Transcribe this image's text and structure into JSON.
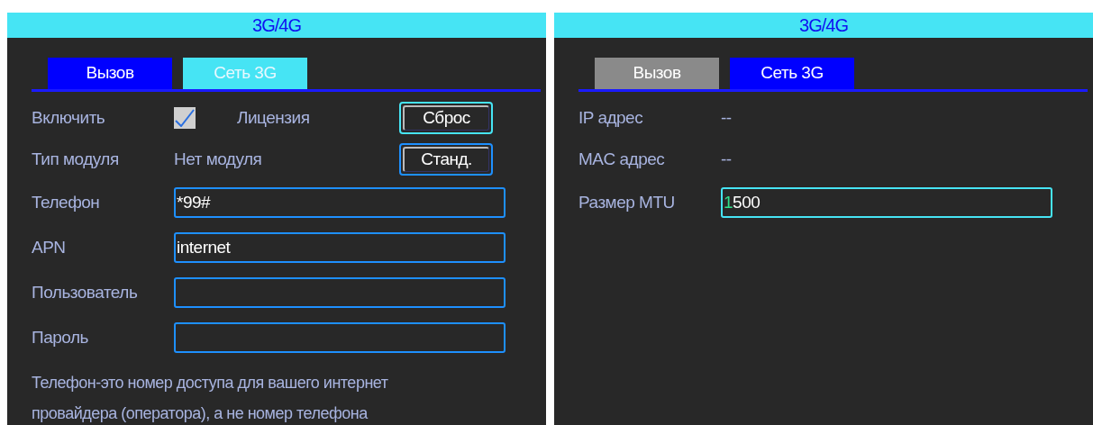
{
  "panels": [
    {
      "title": "3G/4G",
      "tabs": [
        {
          "label": "Вызов",
          "selected": true,
          "focused": false
        },
        {
          "label": "Сеть 3G",
          "selected": false,
          "focused": true
        }
      ],
      "rows": [
        {
          "kind": "checkbox-row",
          "label": "Включить",
          "checked": true,
          "extra_label": "Лицензия",
          "button": {
            "label": "Сброс",
            "focused": true
          }
        },
        {
          "kind": "text-row",
          "label": "Тип модуля",
          "value": "Нет модуля",
          "button": {
            "label": "Станд.",
            "focused": false
          }
        },
        {
          "kind": "field-row",
          "label": "Телефон",
          "value": "*99#",
          "focused": false
        },
        {
          "kind": "field-row",
          "label": "APN",
          "value": "internet",
          "focused": false
        },
        {
          "kind": "field-row",
          "label": "Пользователь",
          "value": "",
          "focused": false
        },
        {
          "kind": "field-row",
          "label": "Пароль",
          "value": "",
          "focused": false
        }
      ],
      "help": [
        "Телефон-это номер доступа для вашего интернет",
        "провайдера (оператора), а не номер телефона"
      ]
    },
    {
      "title": "3G/4G",
      "tabs": [
        {
          "label": "Вызов",
          "selected": false,
          "focused": false
        },
        {
          "label": "Сеть 3G",
          "selected": true,
          "focused": false
        }
      ],
      "rows": [
        {
          "kind": "text-row",
          "label": "IP адрес",
          "value": "--"
        },
        {
          "kind": "text-row",
          "label": "MAC адрес",
          "value": "--"
        },
        {
          "kind": "field-row",
          "label": "Размер MTU",
          "value": "1500",
          "focused": true
        }
      ]
    }
  ]
}
